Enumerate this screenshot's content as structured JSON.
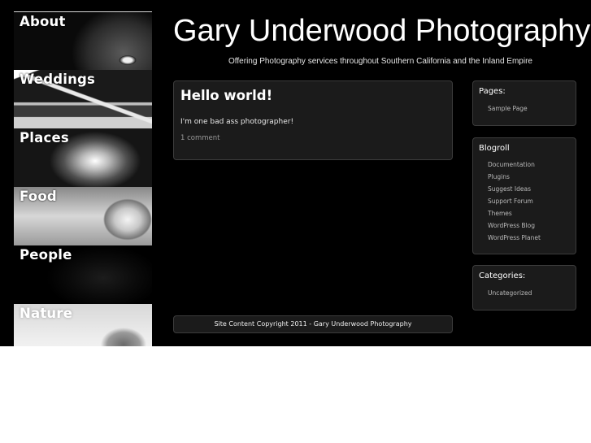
{
  "nav": {
    "items": [
      {
        "label": "About"
      },
      {
        "label": "Weddings"
      },
      {
        "label": "Places"
      },
      {
        "label": "Food"
      },
      {
        "label": "People"
      },
      {
        "label": "Nature"
      }
    ]
  },
  "header": {
    "title": "Gary Underwood Photography",
    "tagline": "Offering Photography services throughout Southern California and the Inland Empire"
  },
  "post": {
    "title": "Hello world!",
    "body": "I'm one bad ass photographer!",
    "comments": "1 comment"
  },
  "footer": {
    "text": "Site Content Copyright 2011 - Gary Underwood Photography"
  },
  "sidebar": {
    "pages": {
      "title": "Pages:",
      "items": [
        "Sample Page"
      ]
    },
    "blogroll": {
      "title": "Blogroll",
      "items": [
        "Documentation",
        "Plugins",
        "Suggest Ideas",
        "Support Forum",
        "Themes",
        "WordPress Blog",
        "WordPress Planet"
      ]
    },
    "categories": {
      "title": "Categories:",
      "items": [
        "Uncategorized"
      ]
    }
  },
  "colors": {
    "background": "#000000",
    "panel": "#1b1b1b",
    "panel_border": "#3c3c3c",
    "text": "#ffffff",
    "link_muted": "#b9b9b9"
  }
}
